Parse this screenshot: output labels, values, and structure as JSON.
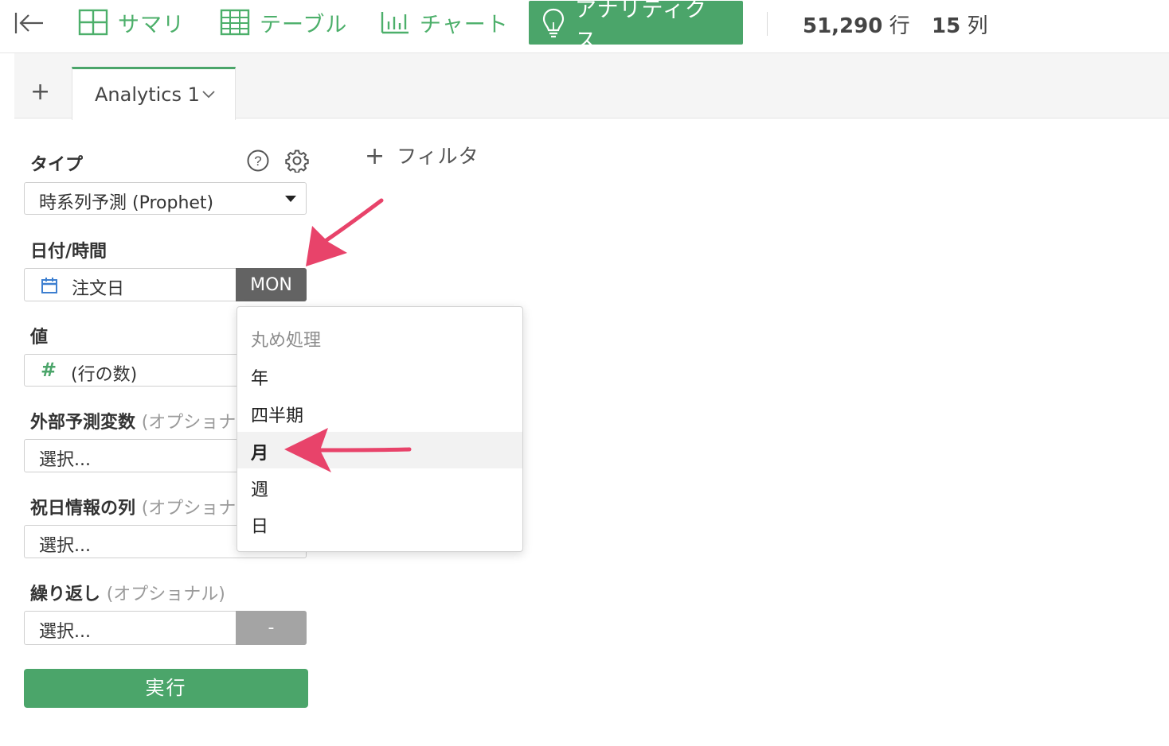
{
  "toolbar": {
    "tabs": [
      {
        "label": "サマリ",
        "icon": "grid-icon"
      },
      {
        "label": "テーブル",
        "icon": "table-icon"
      },
      {
        "label": "チャート",
        "icon": "bar-chart-icon"
      },
      {
        "label": "アナリティクス",
        "icon": "lightbulb-icon",
        "active": true
      }
    ],
    "rows_value": "51,290",
    "rows_unit": "行",
    "cols_value": "15",
    "cols_unit": "列"
  },
  "tabstrip": {
    "add_symbol": "+",
    "active_tab": "Analytics 1"
  },
  "form": {
    "type_label": "タイプ",
    "type_value": "時系列予測 (Prophet)",
    "date_label": "日付/時間",
    "date_value": "注文日",
    "date_addon": "MON",
    "value_label": "値",
    "value_value": "(行の数)",
    "value_icon_text": "#",
    "ext_label": "外部予測変数",
    "ext_opt": "(オプショナル)",
    "ext_placeholder": "選択...",
    "holiday_label": "祝日情報の列",
    "holiday_opt": "(オプショナル)",
    "holiday_placeholder": "選択...",
    "repeat_label": "繰り返し",
    "repeat_opt": "(オプショナル)",
    "repeat_placeholder": "選択...",
    "repeat_addon": "-",
    "run_label": "実行"
  },
  "filter": {
    "label": "フィルタ"
  },
  "dropdown": {
    "header": "丸め処理",
    "items": [
      "年",
      "四半期",
      "月",
      "週",
      "日"
    ],
    "selected": "月"
  },
  "colors": {
    "accent": "#4ba56a",
    "annotation_arrow": "#e8436a",
    "addon_dark": "#636363"
  }
}
